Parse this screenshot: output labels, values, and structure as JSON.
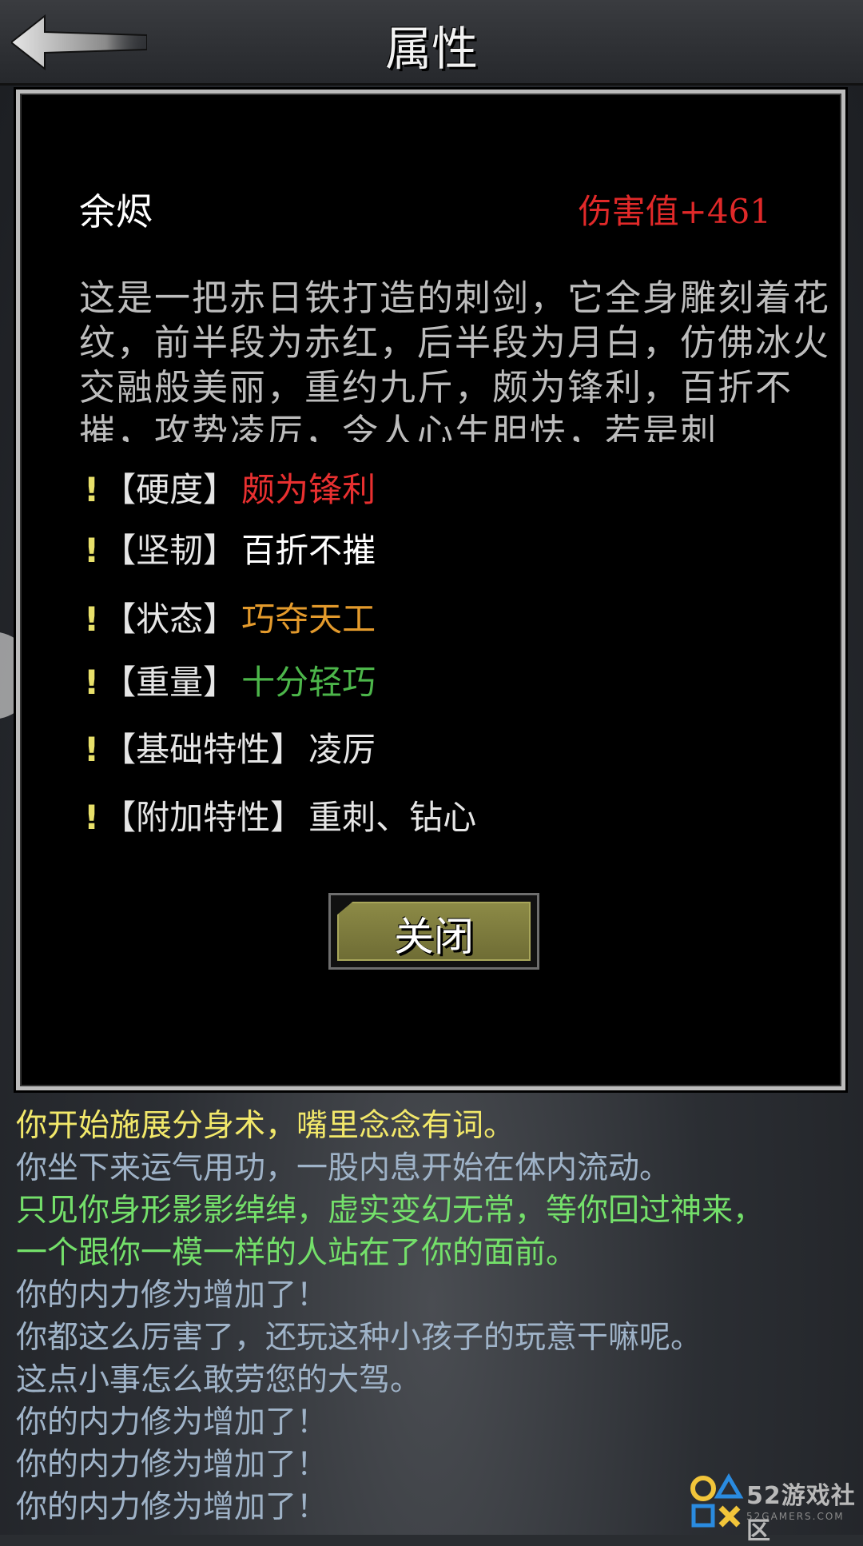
{
  "header": {
    "title": "属性"
  },
  "item": {
    "name": "余烬",
    "damage": "伤害值+461",
    "description": "这是一把赤日铁打造的刺剑，它全身雕刻着花纹，前半段为赤红，后半段为月白，仿佛冰火交融般美丽，重约九斤，颇为锋利，百折不摧，攻势凌厉，令人心生胆怯，若是刺"
  },
  "attributes": [
    {
      "label": "【硬度】",
      "value": "颇为锋利",
      "color": "#e83030"
    },
    {
      "label": "【坚韧】",
      "value": "百折不摧",
      "color": "#ffffff"
    },
    {
      "label": "【状态】",
      "value": "巧夺天工",
      "color": "#e39a2c"
    },
    {
      "label": "【重量】",
      "value": "十分轻巧",
      "color": "#4cb64a"
    },
    {
      "label": "【基础特性】",
      "value": "凌厉",
      "color": "#e6e6e6"
    },
    {
      "label": "【附加特性】",
      "value": "重刺、钻心",
      "color": "#e6e6e6"
    }
  ],
  "attr_marker": "!",
  "close_button": {
    "label": "关闭"
  },
  "log": [
    {
      "text": "你开始施展分身术，嘴里念念有词。",
      "color": "#f2e86a"
    },
    {
      "text": "你坐下来运气用功，一股内息开始在体内流动。",
      "color": "#9fb3c8"
    },
    {
      "text": "只见你身形影影绰绰，虚实变幻无常，等你回过神来，",
      "color": "#74e06a"
    },
    {
      "text": "一个跟你一模一样的人站在了你的面前。",
      "color": "#74e06a"
    },
    {
      "text": "你的内力修为增加了！",
      "color": "#9fb3c8"
    },
    {
      "text": "你都这么厉害了，还玩这种小孩子的玩意干嘛呢。",
      "color": "#9fb3c8"
    },
    {
      "text": "这点小事怎么敢劳您的大驾。",
      "color": "#9fb3c8"
    },
    {
      "text": "你的内力修为增加了！",
      "color": "#9fb3c8"
    },
    {
      "text": "你的内力修为增加了！",
      "color": "#9fb3c8"
    },
    {
      "text": "你的内力修为增加了！",
      "color": "#9fb3c8"
    }
  ],
  "watermark": {
    "text": "52游戏社区",
    "sub": "52GAMERS.COM"
  }
}
